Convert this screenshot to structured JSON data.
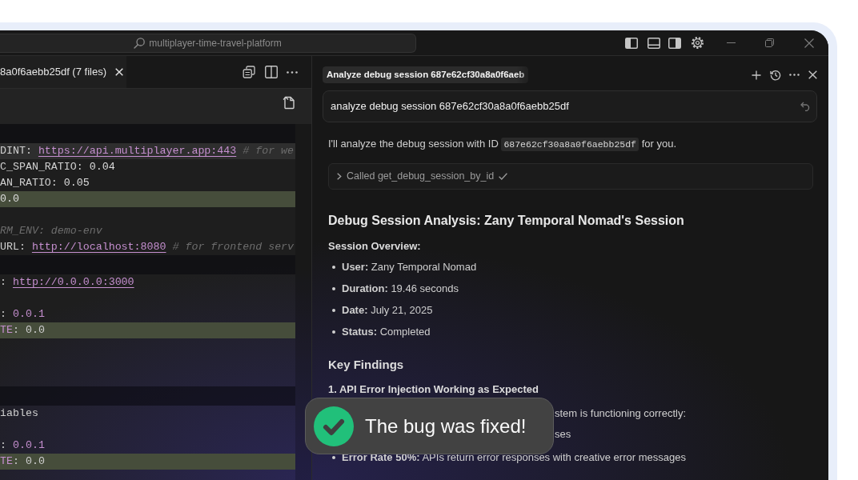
{
  "title_bar": {
    "search": "multiplayer-time-travel-platform"
  },
  "editor": {
    "tab": {
      "label": "8a0f6aebb25df (7 files)",
      "selected": true
    },
    "lines": [
      {
        "kind": "fold",
        "current": false,
        "added": false
      },
      {
        "kind": "code",
        "current": true,
        "added": false,
        "tokens": [
          {
            "kind": "key",
            "text": "DINT: "
          },
          {
            "kind": "link",
            "text": "https://api.multiplayer.app:443"
          },
          {
            "kind": "comment",
            "text": " # for we"
          }
        ]
      },
      {
        "kind": "code",
        "current": false,
        "added": false,
        "tokens": [
          {
            "kind": "key",
            "text": "C_SPAN_RATIO: "
          },
          {
            "kind": "number",
            "text": "0.04"
          }
        ]
      },
      {
        "kind": "code",
        "current": false,
        "added": false,
        "tokens": [
          {
            "kind": "key",
            "text": "AN_RATIO: "
          },
          {
            "kind": "number",
            "text": "0.05"
          }
        ]
      },
      {
        "kind": "code",
        "current": false,
        "added": true,
        "tokens": [
          {
            "kind": "number",
            "text": "0.0"
          }
        ]
      },
      {
        "kind": "blank"
      },
      {
        "kind": "code",
        "current": false,
        "added": false,
        "tokens": [
          {
            "kind": "comment",
            "text": "RM_ENV: demo-env"
          }
        ]
      },
      {
        "kind": "code",
        "current": false,
        "added": false,
        "tokens": [
          {
            "kind": "key",
            "text": "URL: "
          },
          {
            "kind": "link",
            "text": "http://localhost:8080"
          },
          {
            "kind": "comment",
            "text": " # for frontend serv"
          }
        ]
      },
      {
        "kind": "fold",
        "current": false,
        "added": false
      },
      {
        "kind": "code",
        "current": false,
        "added": false,
        "tokens": [
          {
            "kind": "key",
            "text": ": "
          },
          {
            "kind": "link",
            "text": "http://0.0.0.0:3000"
          }
        ]
      },
      {
        "kind": "blank"
      },
      {
        "kind": "code",
        "current": false,
        "added": false,
        "tokens": [
          {
            "kind": "key",
            "text": ": "
          },
          {
            "kind": "accent",
            "text": "0.0.1"
          }
        ]
      },
      {
        "kind": "code",
        "current": false,
        "added": true,
        "tokens": [
          {
            "kind": "accent",
            "text": "TE"
          },
          {
            "kind": "key",
            "text": ": 0.0"
          }
        ]
      },
      {
        "kind": "blank"
      },
      {
        "kind": "blank"
      },
      {
        "kind": "blank"
      },
      {
        "kind": "fold",
        "current": false,
        "added": false
      },
      {
        "kind": "code",
        "current": false,
        "added": false,
        "tokens": [
          {
            "kind": "key",
            "text": "iables"
          }
        ]
      },
      {
        "kind": "blank"
      },
      {
        "kind": "code",
        "current": false,
        "added": false,
        "tokens": [
          {
            "kind": "key",
            "text": ": "
          },
          {
            "kind": "accent",
            "text": "0.0.1"
          }
        ]
      },
      {
        "kind": "code",
        "current": false,
        "added": true,
        "tokens": [
          {
            "kind": "accent",
            "text": "TE"
          },
          {
            "kind": "key",
            "text": ": 0.0"
          }
        ]
      }
    ]
  },
  "chat": {
    "tab_title": "Analyze debug session 687e62cf30a8a0f6aeb",
    "user_message": "analyze debug session 687e62cf30a8a0f6aebb25df",
    "reply": {
      "intro": [
        {
          "kind": "text",
          "text": "I'll analyze the debug session with ID "
        },
        {
          "kind": "code",
          "text": "687e62cf30a8a0f6aebb25df"
        },
        {
          "kind": "text",
          "text": " for you."
        }
      ],
      "tool_call": {
        "label": "Called get_debug_session_by_id",
        "expanded": false,
        "done": true
      },
      "heading": "Debug Session Analysis: Zany Temporal Nomad's Session",
      "overview_title": "Session Overview:",
      "overview": [
        "**User:** Zany Temporal Nomad",
        "**Duration:** 19.46 seconds",
        "**Date:** July 21, 2025",
        "**Status:** Completed"
      ],
      "findings_title": "Key Findings",
      "finding": {
        "title": "1. API Error Injection Working as Expected",
        "intro": {
          "text": "stem is functioning correctly:",
          "covered": true
        },
        "points": [
          {
            "text": "ses",
            "covered": true
          },
          {
            "text": "**Error Rate 50%:** APIs return error responses with creative error messages",
            "covered": false
          }
        ]
      }
    }
  },
  "toast": {
    "kind": "success",
    "message": "The bug was fixed!"
  }
}
